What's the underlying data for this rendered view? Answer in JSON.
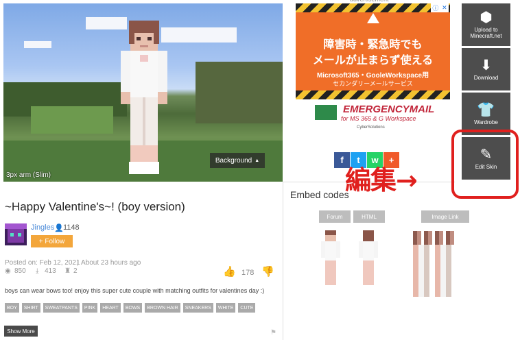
{
  "preview": {
    "arm_caption": "3px arm (Slim)",
    "background_label": "Background",
    "background_caret": "▲"
  },
  "skin": {
    "title": "~Happy Valentine's~! (boy version)",
    "author": "Jingles",
    "follower_count": "1148",
    "follow_label": "+ Follow",
    "posted_on": "Posted on: Feb 12, 2021",
    "separator": "|",
    "posted_ago": "About 23 hours ago",
    "views": "850",
    "downloads": "413",
    "shirts": "2",
    "likes": "178",
    "description": "boys can wear bows too! enjoy this super cute couple with matching outfits for valentines day :)",
    "tags": [
      "BOY",
      "SHIRT",
      "SWEATPANTS",
      "PINK",
      "HEART",
      "BOWS",
      "BROWN HAIR",
      "SNEAKERS",
      "WHITE",
      "CUTE"
    ],
    "show_more": "Show More"
  },
  "ad": {
    "label": "advertisement",
    "line1": "障害時・緊急時でも",
    "line2": "メールが止まらず使える",
    "line3": "Microsoft365・GooleWorkspace用",
    "line4": "セカンダリーメールサービス",
    "brand_title": "EMERGENCYMAIL",
    "brand_subtitle": "for MS 365 & G Workspace",
    "brand_company": "CyberSolutions",
    "close_info": "ⓘ",
    "close_x": "✕"
  },
  "share": {
    "facebook": "f",
    "twitter": "t",
    "whatsapp": "w",
    "more": "+"
  },
  "side_actions": {
    "upload": "Upload to Minecraft.net",
    "download": "Download",
    "wardrobe": "Wardrobe",
    "edit": "Edit Skin"
  },
  "annotation": "編集→",
  "embed": {
    "title": "Embed codes",
    "forum": "Forum",
    "html": "HTML",
    "image_link": "Image Link"
  },
  "colors": {
    "accent": "#f3a63b",
    "annotation": "#e0201e",
    "side_button": "#4d4d4d"
  }
}
